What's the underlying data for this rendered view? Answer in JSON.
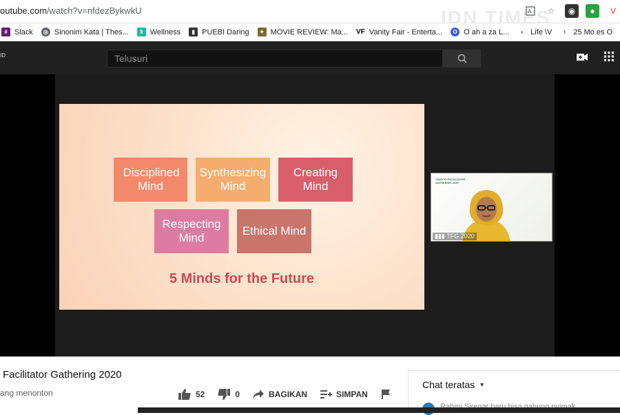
{
  "browser": {
    "url_host": "outube.com",
    "url_path": "/watch?v=nfdezBykwkU",
    "watermark": "IDN TIMES"
  },
  "bookmarks": [
    {
      "label": "Slack",
      "icon": "slack-icon",
      "color": "#611f69"
    },
    {
      "label": "Sinonim Kata | Thes...",
      "icon": "globe-icon",
      "color": "#5f6368"
    },
    {
      "label": "Wellness",
      "icon": "wellness-icon",
      "color": "#1abc9c"
    },
    {
      "label": "PUEBI Daring",
      "icon": "book-icon",
      "color": "#333333"
    },
    {
      "label": "MOVIE REVIEW: Ma...",
      "icon": "movie-icon",
      "color": "#7a6a2a"
    },
    {
      "label": "Vanity Fair - Enterta...",
      "icon": "vf-icon",
      "color": "#000000"
    },
    {
      "label": "O  ah    a   za     L...",
      "icon": "o-icon",
      "color": "#3a5fcd"
    },
    {
      "label": "Life  \\V",
      "icon": "life-icon",
      "color": "#333333"
    },
    {
      "label": "25 Mo  es O",
      "icon": "dots-icon",
      "color": "#333333"
    }
  ],
  "youtube": {
    "logo_text": "ID",
    "search_placeholder": "Telusuri"
  },
  "slide": {
    "boxes": [
      {
        "label": "Disciplined Mind",
        "color": "#f2896a"
      },
      {
        "label": "Synthesizing Mind",
        "color": "#f4ad6e"
      },
      {
        "label": "Creating Mind",
        "color": "#d95e6b"
      },
      {
        "label": "Respecting Mind",
        "color": "#dd7ba0"
      },
      {
        "label": "Ethical Mind",
        "color": "#c9756b"
      }
    ],
    "title": "5 Minds for the Future"
  },
  "camera": {
    "tag": "TFG 2020",
    "caption": "TANOTO FACILITATOR GATHERING 2020"
  },
  "video": {
    "title": "Facilitator Gathering 2020",
    "views": "ang menonton",
    "likes": "52",
    "dislikes": "0",
    "share": "BAGIKAN",
    "save": "SIMPAN"
  },
  "chat": {
    "header": "Chat teratas",
    "message": "Rahmi Siregar  baru bisa gabung   nyimak"
  }
}
